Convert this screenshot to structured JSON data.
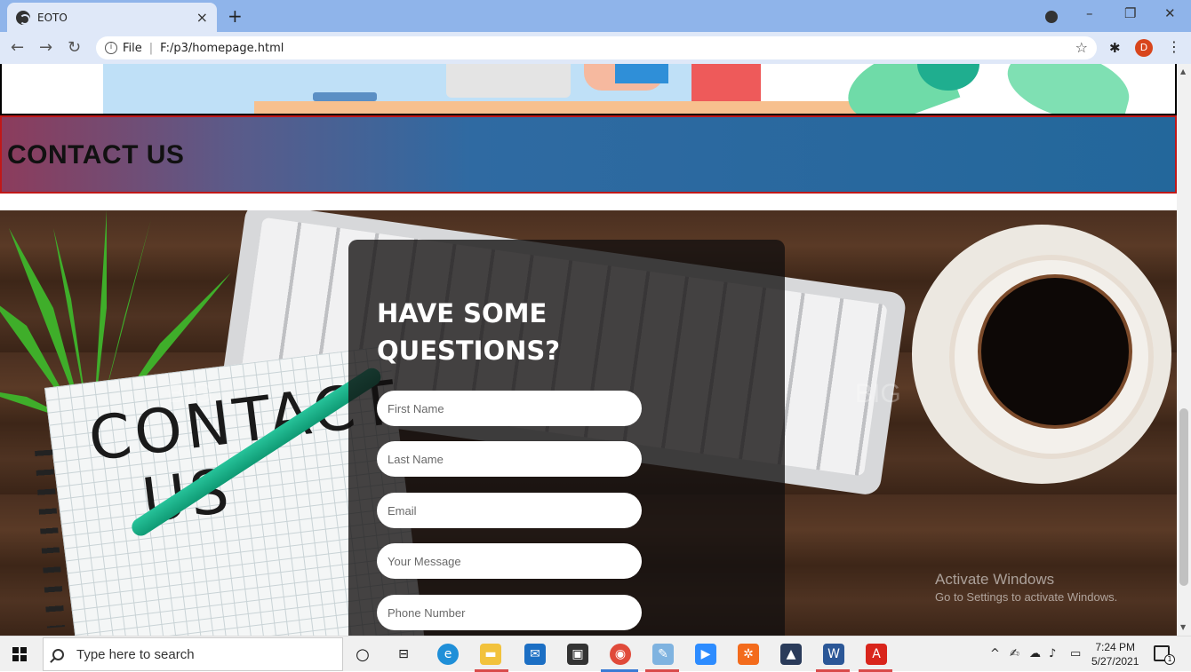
{
  "browser": {
    "tab_title": "EOTO",
    "close_tab": "×",
    "new_tab": "+",
    "url_scheme": "File",
    "url_path": "F:/p3/homepage.html",
    "profile_initial": "D",
    "minimize": "–",
    "restore": "❐",
    "close": "✕"
  },
  "page": {
    "banner_heading": "CONTACT US",
    "notebook_text": "CONTACT US",
    "watermark": "BIGSTOCK",
    "form": {
      "heading": "HAVE SOME QUESTIONS?",
      "fields": [
        {
          "placeholder": "First Name"
        },
        {
          "placeholder": "Last Name"
        },
        {
          "placeholder": "Email"
        },
        {
          "placeholder": "Your Message"
        },
        {
          "placeholder": "Phone Number"
        }
      ]
    },
    "activate": {
      "line1": "Activate Windows",
      "line2": "Go to Settings to activate Windows."
    }
  },
  "taskbar": {
    "search_placeholder": "Type here to search",
    "time": "7:24 PM",
    "date": "5/27/2021",
    "notification_count": "1",
    "apps": [
      "task-view",
      "edge",
      "file-explorer",
      "mail",
      "store",
      "chrome",
      "notepad",
      "zoom",
      "xampp",
      "photos",
      "word",
      "acrobat"
    ]
  },
  "colors": {
    "tabbar": "#8fb4ea",
    "banner_border": "#c01818",
    "banner_gradient_start": "#8c3c5c",
    "banner_gradient_end": "#23679b",
    "form_panel": "rgba(18,16,16,0.78)"
  }
}
